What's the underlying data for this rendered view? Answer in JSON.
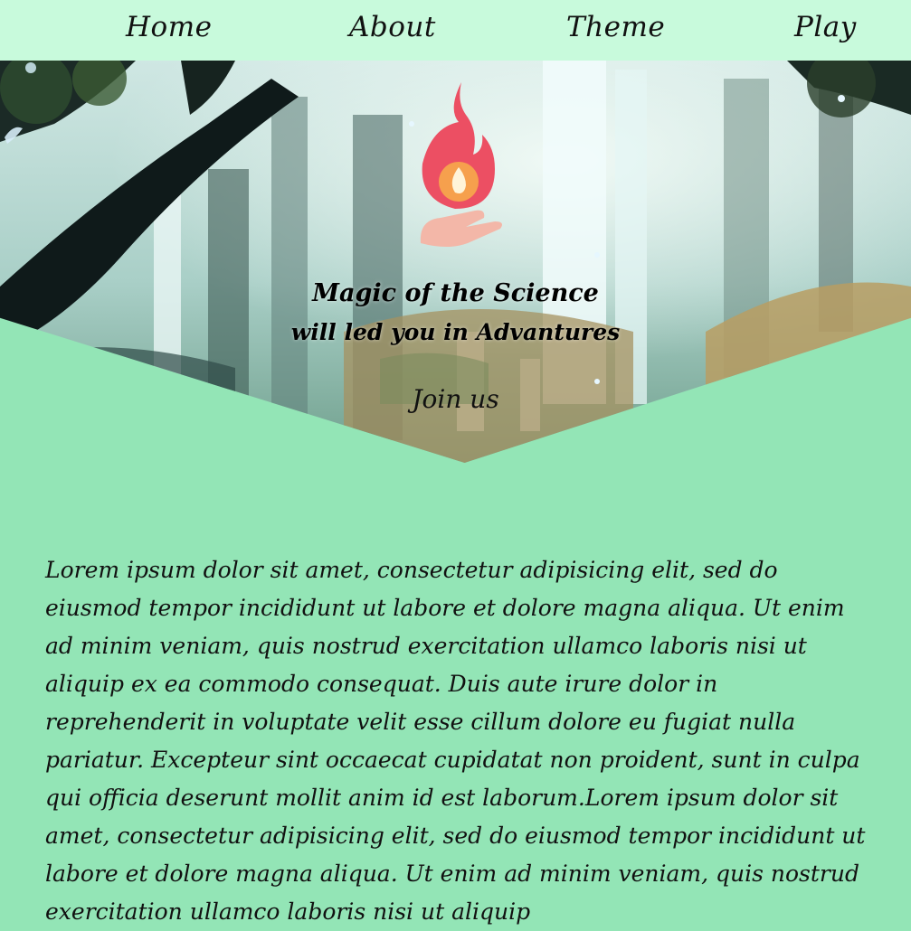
{
  "nav": {
    "items": [
      {
        "label": "Home"
      },
      {
        "label": "About"
      },
      {
        "label": "Theme"
      },
      {
        "label": "Play"
      }
    ]
  },
  "hero": {
    "logo_icon": "flame-in-hand-icon",
    "title_line1": "Magic of the Science",
    "title_line2": "will led you in Advantures",
    "cta_label": "Join us"
  },
  "content": {
    "paragraph": "Lorem ipsum dolor sit amet, consectetur adipisicing elit, sed do eiusmod tempor incididunt ut labore et dolore magna aliqua. Ut enim ad minim veniam, quis nostrud exercitation ullamco laboris nisi ut aliquip ex ea commodo consequat. Duis aute irure dolor in reprehenderit in voluptate velit esse cillum dolore eu fugiat nulla pariatur. Excepteur sint occaecat cupidatat non proident, sunt in culpa qui officia deserunt mollit anim id est laborum.Lorem ipsum dolor sit amet, consectetur adipisicing elit, sed do eiusmod tempor incididunt ut labore et dolore magna aliqua. Ut enim ad minim veniam, quis nostrud exercitation ullamco laboris nisi ut aliquip"
  },
  "colors": {
    "nav_background": "#c8fadc",
    "page_background": "#93e5b6",
    "text": "#111111"
  }
}
